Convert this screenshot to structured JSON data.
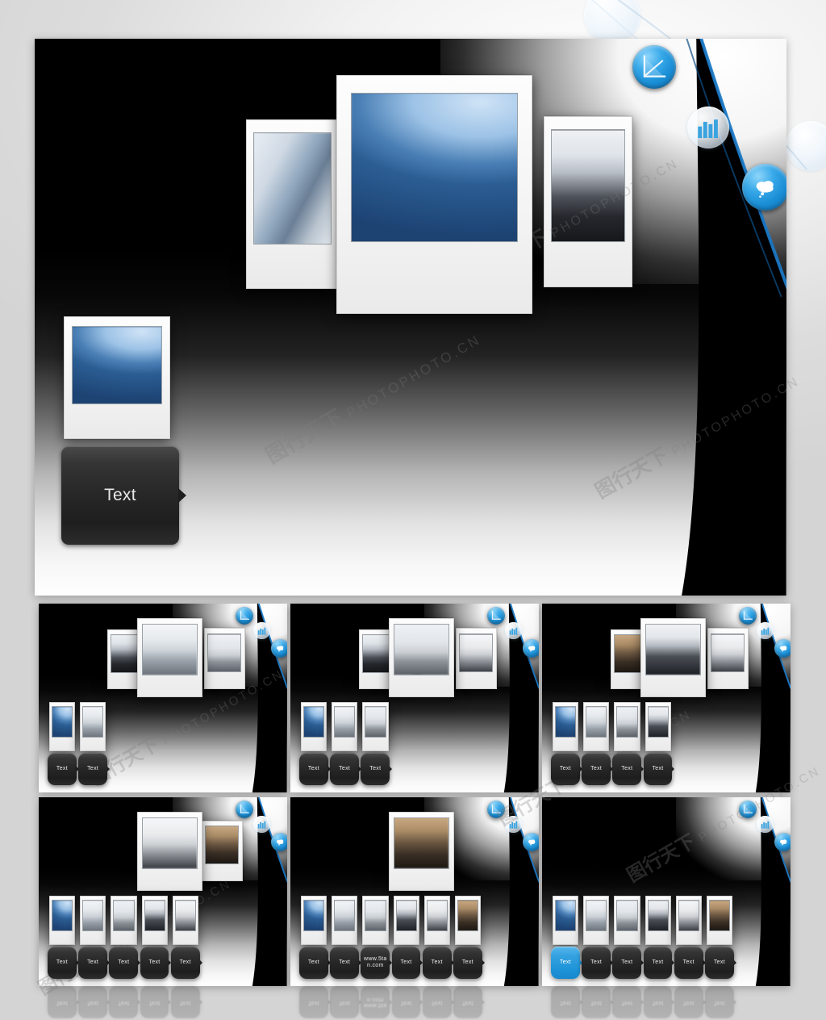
{
  "page": {
    "background_color": "#d9d9d9",
    "watermark_text": "PHOTOPHOTO.CN",
    "watermark_logo": "图行天下"
  },
  "theme": {
    "accent_blue": "#1f94d8",
    "node_blue": "#1a8ed6",
    "button_dark": "#262626",
    "slide_black": "#000000",
    "slide_white": "#ffffff"
  },
  "main_slide": {
    "name": "main-preview-slide",
    "photos": [
      {
        "caption": "",
        "image": "img-tower2",
        "role": "left-photo"
      },
      {
        "caption": "",
        "image": "img-tower",
        "role": "center-photo"
      },
      {
        "caption": "",
        "image": "img-meet",
        "role": "right-photo"
      }
    ],
    "thumbnails": [
      {
        "image": "img-tower"
      }
    ],
    "buttons": [
      {
        "label": "Text",
        "active": false
      }
    ],
    "nodes": [
      {
        "icon": "chart-icon",
        "state": "active"
      },
      {
        "icon": "building-icon",
        "state": "ghost"
      },
      {
        "icon": "cloud-icon",
        "state": "active"
      }
    ]
  },
  "thumb_slides": [
    {
      "name": "slide-2",
      "index": 2,
      "photos": [
        {
          "image": "img-meet",
          "role": "left-photo"
        },
        {
          "image": "img-laptop",
          "role": "center-photo"
        },
        {
          "image": "img-plane",
          "role": "right-photo"
        }
      ],
      "thumbnails": [
        {
          "image": "img-tower"
        },
        {
          "image": "img-laptop"
        }
      ],
      "buttons": [
        {
          "label": "Text",
          "active": false
        },
        {
          "label": "Text",
          "active": false
        }
      ]
    },
    {
      "name": "slide-3",
      "index": 3,
      "photos": [
        {
          "image": "img-meet",
          "role": "left-photo"
        },
        {
          "image": "img-plane",
          "role": "center-photo"
        },
        {
          "image": "img-shake",
          "role": "right-photo"
        }
      ],
      "thumbnails": [
        {
          "image": "img-tower"
        },
        {
          "image": "img-laptop"
        },
        {
          "image": "img-plane"
        }
      ],
      "buttons": [
        {
          "label": "Text",
          "active": false
        },
        {
          "label": "Text",
          "active": false
        },
        {
          "label": "Text",
          "active": false
        }
      ]
    },
    {
      "name": "slide-4",
      "index": 4,
      "photos": [
        {
          "image": "img-board",
          "role": "left-photo"
        },
        {
          "image": "img-group",
          "role": "center-photo"
        },
        {
          "image": "img-shake",
          "role": "right-photo"
        }
      ],
      "thumbnails": [
        {
          "image": "img-tower"
        },
        {
          "image": "img-laptop"
        },
        {
          "image": "img-plane"
        },
        {
          "image": "img-group"
        }
      ],
      "buttons": [
        {
          "label": "Text",
          "active": false
        },
        {
          "label": "Text",
          "active": false
        },
        {
          "label": "Text",
          "active": false
        },
        {
          "label": "Text",
          "active": false
        }
      ]
    },
    {
      "name": "slide-5",
      "index": 5,
      "photos": [
        {
          "image": "img-shake",
          "role": "center-photo"
        },
        {
          "image": "img-board",
          "role": "right-photo"
        }
      ],
      "thumbnails": [
        {
          "image": "img-tower"
        },
        {
          "image": "img-laptop"
        },
        {
          "image": "img-plane"
        },
        {
          "image": "img-group"
        },
        {
          "image": "img-shake"
        }
      ],
      "buttons": [
        {
          "label": "Text",
          "active": false
        },
        {
          "label": "Text",
          "active": false
        },
        {
          "label": "Text",
          "active": false
        },
        {
          "label": "Text",
          "active": false
        },
        {
          "label": "Text",
          "active": false
        }
      ]
    },
    {
      "name": "slide-6",
      "index": 6,
      "photos": [
        {
          "image": "img-board",
          "role": "center-photo"
        }
      ],
      "thumbnails": [
        {
          "image": "img-tower"
        },
        {
          "image": "img-laptop"
        },
        {
          "image": "img-plane"
        },
        {
          "image": "img-group"
        },
        {
          "image": "img-shake"
        },
        {
          "image": "img-board"
        }
      ],
      "buttons": [
        {
          "label": "Text",
          "active": false
        },
        {
          "label": "Text",
          "active": false
        },
        {
          "label": "www.5ta\nn.com",
          "active": false
        },
        {
          "label": "Text",
          "active": false
        },
        {
          "label": "Text",
          "active": false
        },
        {
          "label": "Text",
          "active": false
        }
      ]
    },
    {
      "name": "slide-7",
      "index": 7,
      "photos": [],
      "thumbnails": [
        {
          "image": "img-tower"
        },
        {
          "image": "img-laptop"
        },
        {
          "image": "img-plane"
        },
        {
          "image": "img-group"
        },
        {
          "image": "img-shake"
        },
        {
          "image": "img-board"
        }
      ],
      "buttons": [
        {
          "label": "Text",
          "active": true
        },
        {
          "label": "Text",
          "active": false
        },
        {
          "label": "Text",
          "active": false
        },
        {
          "label": "Text",
          "active": false
        },
        {
          "label": "Text",
          "active": false
        },
        {
          "label": "Text",
          "active": false
        }
      ]
    }
  ]
}
